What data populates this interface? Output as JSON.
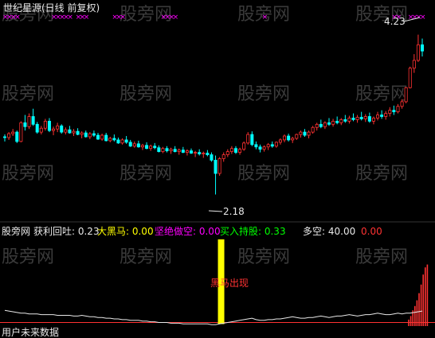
{
  "chart_data": [
    {
      "type": "candlestick",
      "title": "世纪星源(日线 前复权)",
      "annotations": {
        "high_label": "4.23",
        "low_label": "2.18"
      },
      "colors": {
        "up": "#ff3232",
        "down": "#00ffff",
        "signal": "#ff00ff",
        "title": "#e8e8e8",
        "label": "#e8e8e8"
      },
      "price_range": [
        1.9,
        4.45
      ],
      "candles": [
        [
          2.92,
          2.95,
          2.86,
          2.91
        ],
        [
          2.91,
          2.98,
          2.88,
          2.96
        ],
        [
          2.96,
          3.02,
          2.93,
          2.98
        ],
        [
          2.98,
          3.0,
          2.84,
          2.86
        ],
        [
          2.86,
          3.12,
          2.85,
          3.1
        ],
        [
          3.1,
          3.2,
          3.0,
          3.05
        ],
        [
          3.05,
          3.22,
          3.02,
          3.18
        ],
        [
          3.18,
          3.28,
          3.06,
          3.08
        ],
        [
          3.08,
          3.11,
          2.96,
          2.98
        ],
        [
          2.98,
          3.06,
          2.95,
          3.03
        ],
        [
          3.03,
          3.15,
          3.0,
          3.12
        ],
        [
          3.12,
          3.16,
          2.98,
          3.0
        ],
        [
          3.0,
          3.05,
          2.94,
          3.02
        ],
        [
          3.02,
          3.1,
          2.98,
          3.06
        ],
        [
          3.06,
          3.08,
          2.96,
          2.98
        ],
        [
          2.98,
          3.04,
          2.95,
          3.01
        ],
        [
          3.01,
          3.06,
          2.96,
          2.97
        ],
        [
          2.97,
          3.02,
          2.93,
          2.99
        ],
        [
          2.99,
          3.03,
          2.94,
          2.95
        ],
        [
          2.95,
          2.99,
          2.9,
          2.97
        ],
        [
          2.97,
          3.0,
          2.91,
          2.92
        ],
        [
          2.92,
          2.98,
          2.89,
          2.96
        ],
        [
          2.96,
          3.0,
          2.92,
          2.94
        ],
        [
          2.94,
          2.97,
          2.88,
          2.89
        ],
        [
          2.89,
          2.96,
          2.87,
          2.94
        ],
        [
          2.94,
          2.97,
          2.86,
          2.87
        ],
        [
          2.87,
          2.92,
          2.85,
          2.9
        ],
        [
          2.9,
          2.95,
          2.86,
          2.88
        ],
        [
          2.88,
          2.91,
          2.83,
          2.84
        ],
        [
          2.84,
          2.9,
          2.82,
          2.88
        ],
        [
          2.88,
          2.93,
          2.83,
          2.85
        ],
        [
          2.85,
          2.88,
          2.79,
          2.8
        ],
        [
          2.8,
          2.86,
          2.78,
          2.83
        ],
        [
          2.83,
          2.87,
          2.78,
          2.79
        ],
        [
          2.79,
          2.83,
          2.75,
          2.81
        ],
        [
          2.81,
          2.85,
          2.76,
          2.77
        ],
        [
          2.77,
          2.82,
          2.74,
          2.8
        ],
        [
          2.8,
          2.84,
          2.76,
          2.78
        ],
        [
          2.78,
          2.81,
          2.72,
          2.73
        ],
        [
          2.73,
          2.79,
          2.71,
          2.77
        ],
        [
          2.77,
          2.8,
          2.72,
          2.74
        ],
        [
          2.74,
          2.78,
          2.7,
          2.76
        ],
        [
          2.76,
          2.8,
          2.72,
          2.73
        ],
        [
          2.73,
          2.77,
          2.69,
          2.75
        ],
        [
          2.75,
          2.79,
          2.71,
          2.72
        ],
        [
          2.72,
          2.76,
          2.68,
          2.74
        ],
        [
          2.74,
          2.77,
          2.7,
          2.71
        ],
        [
          2.71,
          2.74,
          2.66,
          2.72
        ],
        [
          2.72,
          2.76,
          2.68,
          2.7
        ],
        [
          2.7,
          2.73,
          2.65,
          2.71
        ],
        [
          2.71,
          2.75,
          2.67,
          2.69
        ],
        [
          2.69,
          2.72,
          2.6,
          2.62
        ],
        [
          2.62,
          2.68,
          2.18,
          2.45
        ],
        [
          2.45,
          2.66,
          2.42,
          2.64
        ],
        [
          2.64,
          2.72,
          2.6,
          2.69
        ],
        [
          2.69,
          2.76,
          2.66,
          2.73
        ],
        [
          2.73,
          2.8,
          2.7,
          2.77
        ],
        [
          2.77,
          2.8,
          2.7,
          2.72
        ],
        [
          2.72,
          2.78,
          2.69,
          2.76
        ],
        [
          2.76,
          2.86,
          2.74,
          2.84
        ],
        [
          2.84,
          2.98,
          2.82,
          2.95
        ],
        [
          2.95,
          2.99,
          2.8,
          2.82
        ],
        [
          2.82,
          2.86,
          2.76,
          2.79
        ],
        [
          2.79,
          2.82,
          2.72,
          2.76
        ],
        [
          2.76,
          2.81,
          2.73,
          2.79
        ],
        [
          2.79,
          2.84,
          2.75,
          2.82
        ],
        [
          2.82,
          2.86,
          2.78,
          2.8
        ],
        [
          2.8,
          2.86,
          2.78,
          2.85
        ],
        [
          2.85,
          2.9,
          2.82,
          2.88
        ],
        [
          2.88,
          2.95,
          2.85,
          2.93
        ],
        [
          2.93,
          2.96,
          2.86,
          2.88
        ],
        [
          2.88,
          2.92,
          2.84,
          2.9
        ],
        [
          2.9,
          2.96,
          2.88,
          2.95
        ],
        [
          2.95,
          3.0,
          2.91,
          2.98
        ],
        [
          2.98,
          3.02,
          2.92,
          2.94
        ],
        [
          2.94,
          3.0,
          2.9,
          2.98
        ],
        [
          2.98,
          3.06,
          2.96,
          3.04
        ],
        [
          3.04,
          3.1,
          3.0,
          3.08
        ],
        [
          3.08,
          3.14,
          3.03,
          3.05
        ],
        [
          3.05,
          3.12,
          3.02,
          3.1
        ],
        [
          3.1,
          3.16,
          3.06,
          3.08
        ],
        [
          3.08,
          3.15,
          3.05,
          3.12
        ],
        [
          3.12,
          3.18,
          3.08,
          3.1
        ],
        [
          3.1,
          3.16,
          3.07,
          3.14
        ],
        [
          3.14,
          3.2,
          3.1,
          3.12
        ],
        [
          3.12,
          3.19,
          3.09,
          3.16
        ],
        [
          3.16,
          3.22,
          3.12,
          3.14
        ],
        [
          3.14,
          3.2,
          3.1,
          3.17
        ],
        [
          3.17,
          3.24,
          3.13,
          3.15
        ],
        [
          3.15,
          3.21,
          3.11,
          3.18
        ],
        [
          3.18,
          3.23,
          3.1,
          3.12
        ],
        [
          3.12,
          3.18,
          3.08,
          3.16
        ],
        [
          3.16,
          3.24,
          3.13,
          3.2
        ],
        [
          3.2,
          3.26,
          3.15,
          3.18
        ],
        [
          3.18,
          3.25,
          3.14,
          3.22
        ],
        [
          3.22,
          3.3,
          3.18,
          3.26
        ],
        [
          3.26,
          3.32,
          3.2,
          3.24
        ],
        [
          3.24,
          3.34,
          3.22,
          3.31
        ],
        [
          3.31,
          3.4,
          3.28,
          3.37
        ],
        [
          3.37,
          3.56,
          3.35,
          3.55
        ],
        [
          3.55,
          3.82,
          3.54,
          3.8
        ],
        [
          3.8,
          3.98,
          3.74,
          3.9
        ],
        [
          3.9,
          4.23,
          3.88,
          4.1
        ],
        [
          4.1,
          4.18,
          3.95,
          4.02
        ]
      ],
      "signal_marks": [
        [
          0,
          1,
          2,
          3
        ],
        [
          12,
          13,
          14,
          15,
          16,
          18,
          19,
          20
        ],
        [
          27,
          28,
          29
        ],
        [
          39,
          40,
          41,
          42
        ],
        [
          64
        ],
        [
          96,
          97
        ],
        [
          100,
          101,
          102,
          103
        ]
      ]
    },
    {
      "type": "line",
      "legend": [
        {
          "label": "股旁网",
          "value": "",
          "color": "#e8e8e8"
        },
        {
          "label": "获利回吐:",
          "value": "0.23",
          "color": "#e8e8e8"
        },
        {
          "label": "大黑马:",
          "value": "0.00",
          "color": "#ffff00"
        },
        {
          "label": "坚绝做空:",
          "value": "0.00",
          "color": "#ff00ff"
        },
        {
          "label": "买入持股:",
          "value": "0.33",
          "color": "#00ff00"
        },
        {
          "label": "多空:",
          "value": "40.00",
          "color": "#e8e8e8"
        },
        {
          "label": "",
          "value": "0.00",
          "color": "#ff3232"
        }
      ],
      "annotations": {
        "signal_text": "黑马出现",
        "watermark": "股旁网"
      },
      "footer": "用户未来数据",
      "y_range": [
        0,
        100
      ],
      "line_values": [
        22,
        21,
        20,
        19,
        18,
        18,
        17,
        17,
        17,
        16,
        16,
        16,
        16,
        15,
        15,
        15,
        15,
        14,
        14,
        15,
        14,
        13,
        13,
        12,
        12,
        11,
        11,
        10,
        10,
        9,
        9,
        8,
        8,
        8,
        7,
        7,
        6,
        6,
        5,
        5,
        5,
        4,
        4,
        4,
        3,
        3,
        3,
        3,
        3,
        3,
        3,
        2,
        2,
        3,
        4,
        5,
        6,
        7,
        8,
        9,
        10,
        11,
        9,
        8,
        8,
        9,
        9,
        10,
        10,
        11,
        12,
        13,
        12,
        11,
        11,
        12,
        12,
        13,
        14,
        13,
        12,
        13,
        14,
        14,
        15,
        16,
        15,
        14,
        15,
        16,
        16,
        17,
        18,
        17,
        16,
        16,
        17,
        18,
        17,
        18,
        18,
        19,
        20,
        21
      ],
      "baseline_value": 5,
      "signal_index": 52,
      "red_bars": [
        [
          100,
          9
        ],
        [
          101,
          14
        ],
        [
          102,
          22
        ],
        [
          103,
          28
        ],
        [
          104,
          36
        ],
        [
          105,
          46
        ],
        [
          106,
          58
        ],
        [
          107,
          72
        ],
        [
          108,
          82
        ],
        [
          109,
          86
        ]
      ]
    }
  ]
}
